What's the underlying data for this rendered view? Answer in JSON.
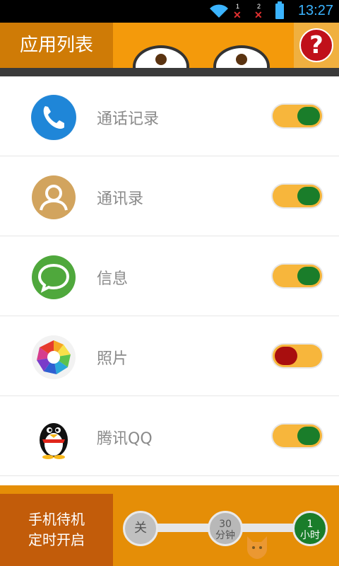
{
  "status_bar": {
    "time": "13:27",
    "sim1_label": "1",
    "sim2_label": "2",
    "icons": [
      "wifi-icon",
      "sim-no-signal-icon",
      "sim-no-signal-icon",
      "battery-icon"
    ]
  },
  "header": {
    "title": "应用列表",
    "help_label": "?"
  },
  "apps": [
    {
      "name": "通话记录",
      "icon": "phone-icon",
      "enabled": true
    },
    {
      "name": "通讯录",
      "icon": "contacts-icon",
      "enabled": true
    },
    {
      "name": "信息",
      "icon": "message-icon",
      "enabled": true
    },
    {
      "name": "照片",
      "icon": "photos-icon",
      "enabled": false
    },
    {
      "name": "腾讯QQ",
      "icon": "qq-penguin-icon",
      "enabled": true
    }
  ],
  "standby_timer": {
    "label_line1": "手机待机",
    "label_line2": "定时开启",
    "options": [
      {
        "line1": "关",
        "line2": ""
      },
      {
        "line1": "30",
        "line2": "分钟"
      },
      {
        "line1": "1",
        "line2": "小时"
      }
    ],
    "selected_index": 2
  },
  "colors": {
    "accent_orange": "#f49a0b",
    "toggle_on": "#1a7d2a",
    "toggle_off": "#a80e0e",
    "help_red": "#c0101a"
  }
}
